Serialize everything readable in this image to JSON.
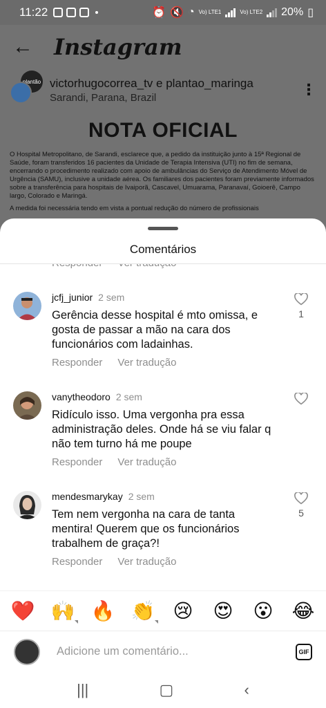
{
  "status_bar": {
    "time": "11:22",
    "battery": "20%",
    "lte1": "Vo) LTE1",
    "lte2": "Vo) LTE2"
  },
  "app": {
    "title": "Instagram",
    "back_icon": "arrow-left-icon"
  },
  "post": {
    "authors": "victorhugocorrea_tv e plantao_maringa",
    "location": "Sarandi, Parana, Brazil",
    "headline": "NOTA OFICIAL",
    "paragraph1": "O Hospital Metropolitano, de Sarandi, esclarece que, a pedido da instituição junto à 15ª Regional de Saúde, foram transferidos 16 pacientes da Unidade de Terapia Intensiva (UTI) no fim de semana, encerrando o procedimento realizado com apoio de ambulâncias do Serviço de Atendimento Móvel de Urgência (SAMU), inclusive a unidade aérea. Os familiares dos pacientes foram previamente informados sobre a transferência para hospitais de Ivaiporã, Cascavel, Umuarama, Paranavaí, Goioerê, Campo largo, Colorado e Maringá.",
    "paragraph2": "A medida foi necessária tendo em vista a pontual redução do número de profissionais"
  },
  "sheet": {
    "title": "Comentários",
    "reply_label": "Responder",
    "translate_label": "Ver tradução",
    "comments": [
      {
        "user": "jcfj_junior",
        "time": "2 sem",
        "text": "Gerência desse hospital é mto omissa, e gosta de passar a mão na cara dos funcionários com ladainhas.",
        "likes": "1"
      },
      {
        "user": "vanytheodoro",
        "time": "2 sem",
        "text": "Ridículo isso. Uma vergonha pra essa administração deles. Onde há se viu falar q não tem turno há me poupe",
        "likes": ""
      },
      {
        "user": "mendesmarykay",
        "time": "2 sem",
        "text": "Tem nem vergonha na cara de tanta mentira! Querem que os funcionários trabalhem de graça?!",
        "likes": "5"
      }
    ],
    "emojis": [
      "❤️",
      "🙌",
      "🔥",
      "👏",
      "😢",
      "😍",
      "😮",
      "😂"
    ],
    "input_placeholder": "Adicione um comentário...",
    "gif_label": "GIF"
  }
}
